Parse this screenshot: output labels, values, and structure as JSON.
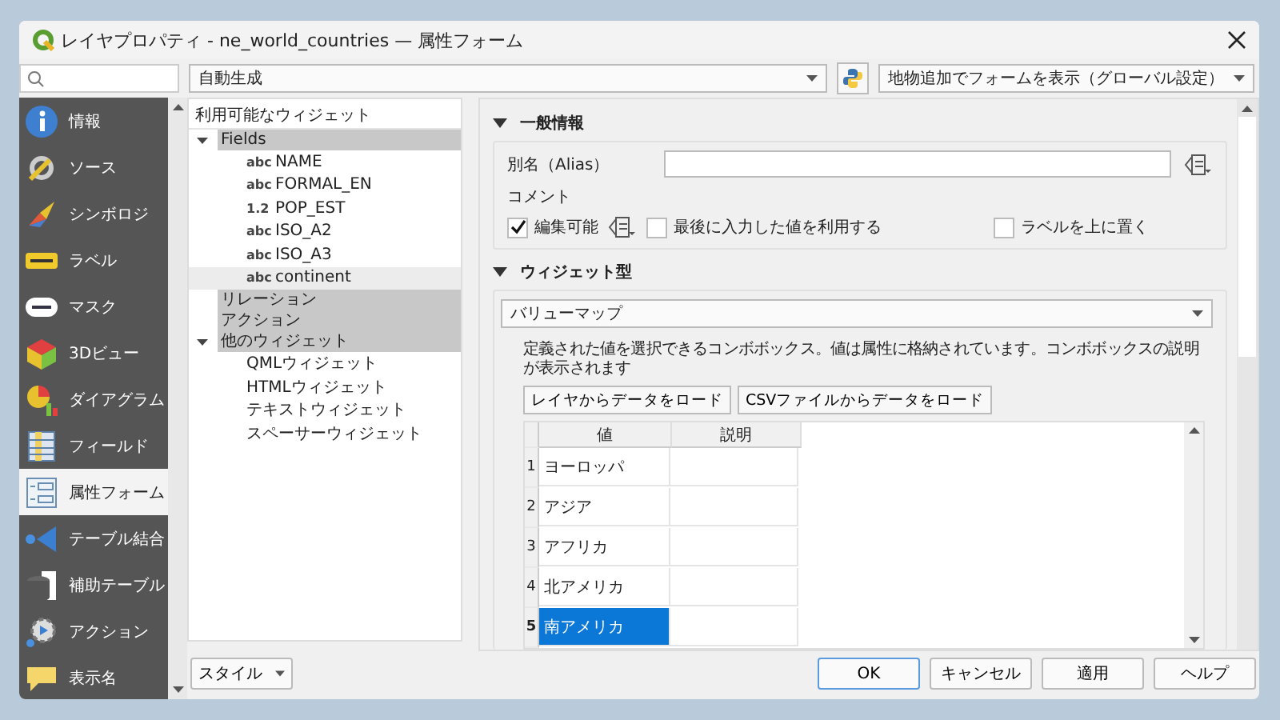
{
  "window": {
    "title": "レイヤプロパティ - ne_world_countries — 属性フォーム"
  },
  "toolbar": {
    "layout_combo": "自動生成",
    "suppress_combo": "地物追加でフォームを表示（グローバル設定）"
  },
  "sidebar": {
    "items": [
      {
        "label": "情報",
        "kind": "info",
        "selected": false
      },
      {
        "label": "ソース",
        "kind": "source",
        "selected": false
      },
      {
        "label": "シンボロジ",
        "kind": "symbology",
        "selected": false
      },
      {
        "label": "ラベル",
        "kind": "labels",
        "selected": false
      },
      {
        "label": "マスク",
        "kind": "mask",
        "selected": false
      },
      {
        "label": "3Dビュー",
        "kind": "view3d",
        "selected": false
      },
      {
        "label": "ダイアグラム",
        "kind": "diagram",
        "selected": false
      },
      {
        "label": "フィールド",
        "kind": "fields",
        "selected": false
      },
      {
        "label": "属性フォーム",
        "kind": "form",
        "selected": true
      },
      {
        "label": "テーブル結合",
        "kind": "joins",
        "selected": false
      },
      {
        "label": "補助テーブル",
        "kind": "auxiliary",
        "selected": false
      },
      {
        "label": "アクション",
        "kind": "actions",
        "selected": false
      },
      {
        "label": "表示名",
        "kind": "display",
        "selected": false
      }
    ]
  },
  "tree": {
    "header": "利用可能なウィジェット",
    "nodes": [
      {
        "label": "Fields",
        "kind": "category",
        "expanded": true,
        "selected": false,
        "children": [
          {
            "label": "NAME",
            "type": "abc",
            "selected": false
          },
          {
            "label": "FORMAL_EN",
            "type": "abc",
            "selected": false
          },
          {
            "label": "POP_EST",
            "type": "1.2",
            "selected": false
          },
          {
            "label": "ISO_A2",
            "type": "abc",
            "selected": false
          },
          {
            "label": "ISO_A3",
            "type": "abc",
            "selected": false
          },
          {
            "label": "continent",
            "type": "abc",
            "selected": true
          }
        ]
      },
      {
        "label": "リレーション",
        "kind": "category",
        "selected": false
      },
      {
        "label": "アクション",
        "kind": "category",
        "selected": false
      },
      {
        "label": "他のウィジェット",
        "kind": "category",
        "expanded": true,
        "selected": false,
        "children": [
          {
            "label": "QMLウィジェット",
            "selected": false
          },
          {
            "label": "HTMLウィジェット",
            "selected": false
          },
          {
            "label": "テキストウィジェット",
            "selected": false
          },
          {
            "label": "スペーサーウィジェット",
            "selected": false
          }
        ]
      }
    ]
  },
  "general": {
    "title": "一般情報",
    "expanded": true,
    "alias_label": "別名（Alias）",
    "comment_label": "コメント",
    "checkboxes": [
      {
        "label": "編集可能",
        "checked": true
      },
      {
        "label": "最後に入力した値を利用する",
        "checked": false
      },
      {
        "label": "ラベルを上に置く",
        "checked": false
      }
    ]
  },
  "widget": {
    "title": "ウィジェット型",
    "expanded": true,
    "type": "バリューマップ",
    "description": "定義された値を選択できるコンボボックス。値は属性に格納されています。コンボボックスの説明が表示されます",
    "buttons": [
      "レイヤからデータをロード",
      "CSVファイルからデータをロード"
    ],
    "table": {
      "columns": [
        "値",
        "説明"
      ],
      "rows": [
        {
          "number": "1",
          "value": "ヨーロッパ",
          "selected": false
        },
        {
          "number": "2",
          "value": "アジア",
          "selected": false
        },
        {
          "number": "3",
          "value": "アフリカ",
          "selected": false
        },
        {
          "number": "4",
          "value": "北アメリカ",
          "selected": false
        },
        {
          "number": "5",
          "value": "南アメリカ",
          "selected": true
        }
      ]
    }
  },
  "bottom": {
    "style_button": "スタイル",
    "buttons": [
      "OK",
      "キャンセル",
      "適用",
      "ヘルプ"
    ]
  }
}
